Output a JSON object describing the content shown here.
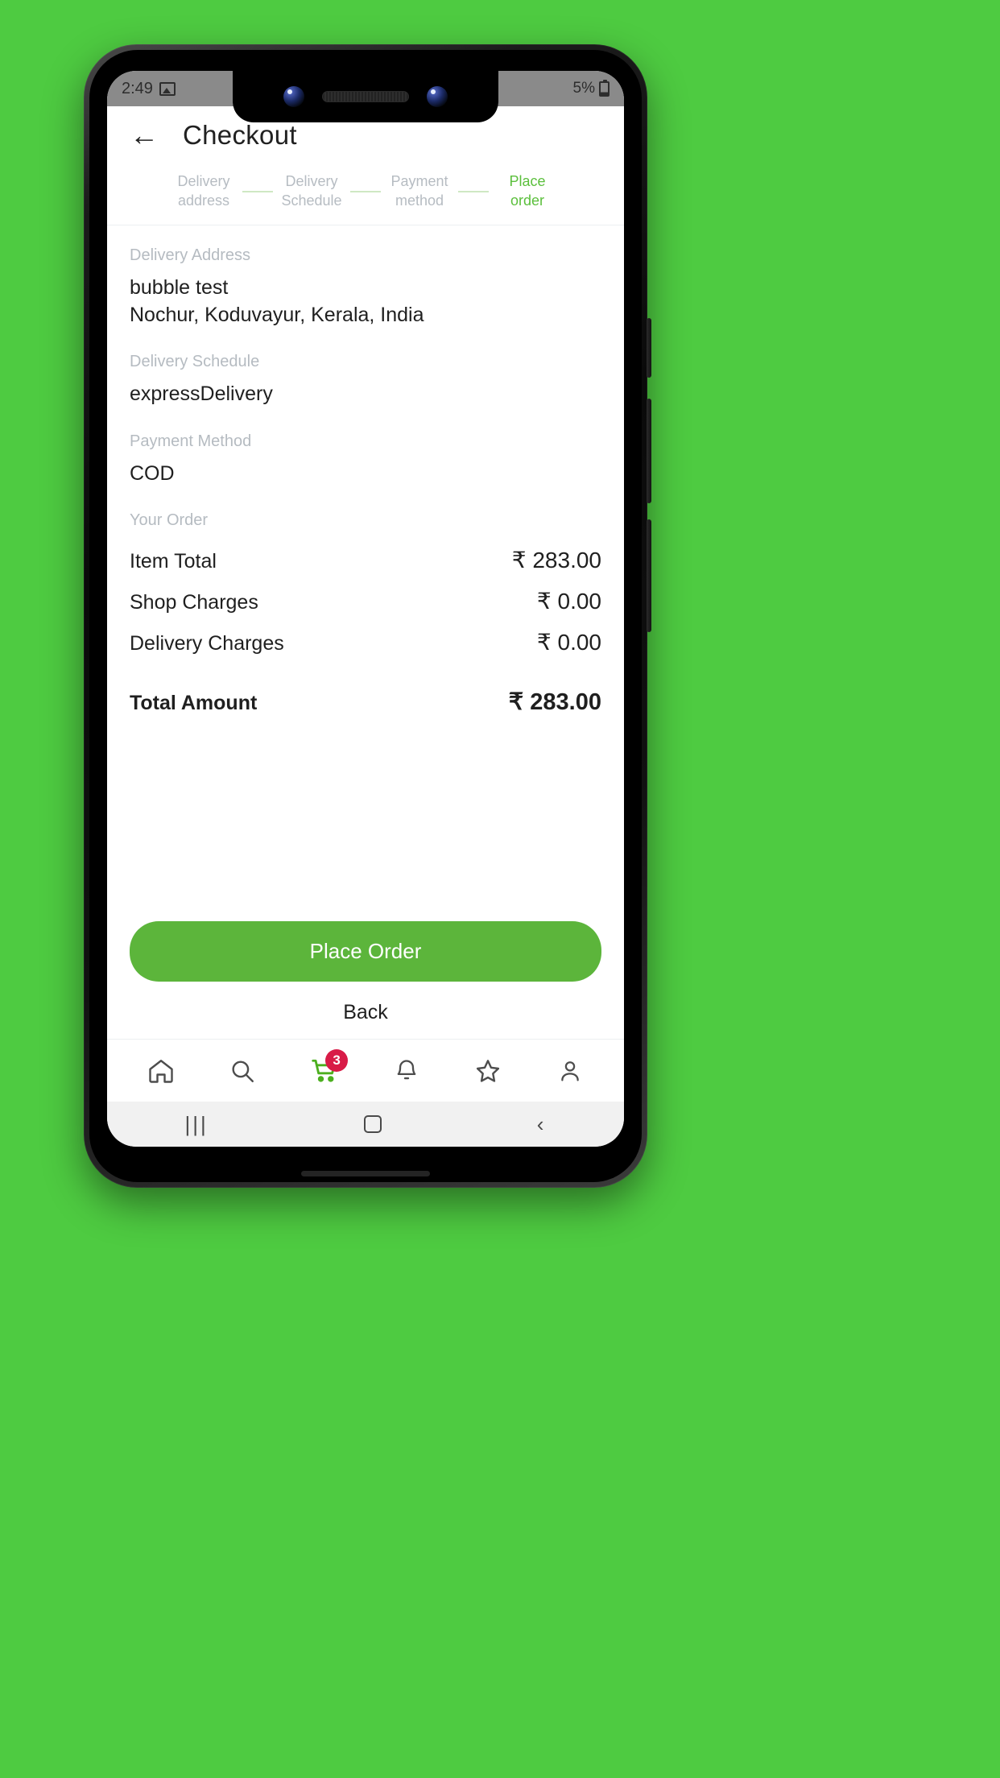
{
  "status_bar": {
    "time": "2:49",
    "image_icon": "image-icon",
    "battery_text": "5%",
    "battery_icon": "battery-icon"
  },
  "appbar": {
    "back_icon": "back-arrow-icon",
    "title": "Checkout"
  },
  "stepper": {
    "steps": [
      {
        "label": "Delivery address",
        "active": false
      },
      {
        "label": "Delivery Schedule",
        "active": false
      },
      {
        "label": "Payment method",
        "active": false
      },
      {
        "label": "Place order",
        "active": true
      }
    ]
  },
  "sections": {
    "delivery_address": {
      "label": "Delivery Address",
      "name": "bubble test",
      "address": "Nochur, Koduvayur, Kerala, India"
    },
    "delivery_schedule": {
      "label": "Delivery Schedule",
      "value": "expressDelivery"
    },
    "payment_method": {
      "label": "Payment Method",
      "value": "COD"
    },
    "your_order": {
      "label": "Your Order",
      "rows": [
        {
          "key": "Item Total",
          "value": "₹ 283.00"
        },
        {
          "key": "Shop Charges",
          "value": "₹ 0.00"
        },
        {
          "key": "Delivery Charges",
          "value": "₹ 0.00"
        }
      ],
      "total": {
        "key": "Total Amount",
        "value": "₹ 283.00"
      }
    }
  },
  "actions": {
    "place_order_label": "Place Order",
    "back_label": "Back"
  },
  "bottom_nav": {
    "items": [
      {
        "icon": "home-icon",
        "name": "home"
      },
      {
        "icon": "search-icon",
        "name": "search"
      },
      {
        "icon": "cart-icon",
        "name": "cart",
        "badge": "3"
      },
      {
        "icon": "bell-icon",
        "name": "notifications"
      },
      {
        "icon": "star-icon",
        "name": "favourites"
      },
      {
        "icon": "person-icon",
        "name": "account"
      }
    ]
  },
  "system_nav": {
    "recents": "|||",
    "home": "home-square-icon",
    "back": "‹"
  },
  "colors": {
    "accent_green": "#5cb53b",
    "badge_red": "#d81b47",
    "wallpaper": "#4ECB41"
  }
}
